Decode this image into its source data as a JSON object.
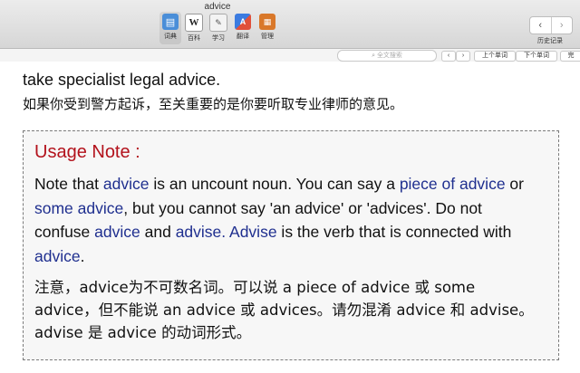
{
  "window": {
    "title": "advice"
  },
  "toolbar": {
    "tools": [
      {
        "label": "词典",
        "icon": "dictionary-icon",
        "active": true
      },
      {
        "label": "百科",
        "icon": "wikipedia-icon"
      },
      {
        "label": "学习",
        "icon": "learning-icon"
      },
      {
        "label": "翻译",
        "icon": "translate-icon"
      },
      {
        "label": "管理",
        "icon": "manage-icon"
      }
    ],
    "history_label": "历史记录",
    "back_glyph": "‹",
    "forward_glyph": "›"
  },
  "searchbar": {
    "placeholder": "全文搜索",
    "prev_glyph": "‹",
    "next_glyph": "›",
    "prev_word": "上个单词",
    "next_word": "下个单词",
    "extra": "完"
  },
  "entry": {
    "sentence_en": "take specialist legal advice.",
    "sentence_zh": "如果你受到警方起诉，至关重要的是你要听取专业律师的意见。"
  },
  "usage_note": {
    "title": "Usage Note :",
    "en_parts": [
      "Note that ",
      "advice",
      " is an uncount noun. You can say a ",
      "piece of advice",
      " or ",
      "some advice",
      ", but you cannot say 'an advice' or 'advices'. Do not confuse ",
      "advice",
      " and ",
      "advise. Advise",
      " is the verb that is connected with ",
      "advice",
      "."
    ],
    "zh": "注意，advice为不可数名词。可以说 a piece of advice 或 some advice，但不能说 an advice 或 advices。请勿混淆 advice 和 advise。advise 是 advice 的动词形式。"
  },
  "colors": {
    "title_red": "#b3121c",
    "link_blue": "#1f2f8f"
  }
}
